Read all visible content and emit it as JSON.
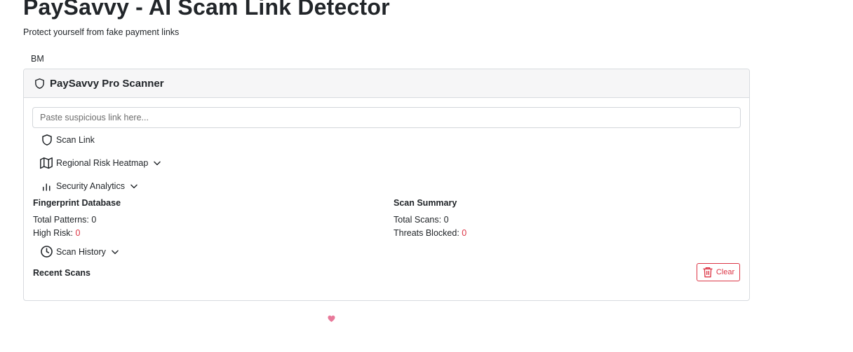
{
  "header": {
    "title": "PaySavvy - AI Scam Link Detector",
    "subtitle": "Protect yourself from fake payment links",
    "user_initials": "BM"
  },
  "card": {
    "title": "PaySavvy Pro Scanner",
    "title_icon": "shield-icon",
    "input": {
      "placeholder": "Paste suspicious link here...",
      "value": ""
    },
    "scan_button": {
      "label": "Scan Link",
      "icon": "shield-icon"
    },
    "heatmap_toggle": {
      "label": "Regional Risk Heatmap",
      "icon": "map-icon"
    },
    "analytics_toggle": {
      "label": "Security Analytics",
      "icon": "bar-chart-icon"
    },
    "fingerprint": {
      "heading": "Fingerprint Database",
      "total_patterns_label": "Total Patterns:",
      "total_patterns_value": "0",
      "high_risk_label": "High Risk:",
      "high_risk_value": "0"
    },
    "summary": {
      "heading": "Scan Summary",
      "total_scans_label": "Total Scans:",
      "total_scans_value": "0",
      "threats_blocked_label": "Threats Blocked:",
      "threats_blocked_value": "0"
    },
    "history_toggle": {
      "label": "Scan History",
      "icon": "clock-icon"
    },
    "recent_scans": {
      "heading": "Recent Scans",
      "clear_label": "Clear",
      "clear_icon": "trash-icon"
    }
  },
  "footer": {
    "icon": "heart-icon"
  },
  "colors": {
    "danger": "#dc3545",
    "heart": "#e8799a",
    "header_bg": "#f6f6f7"
  }
}
